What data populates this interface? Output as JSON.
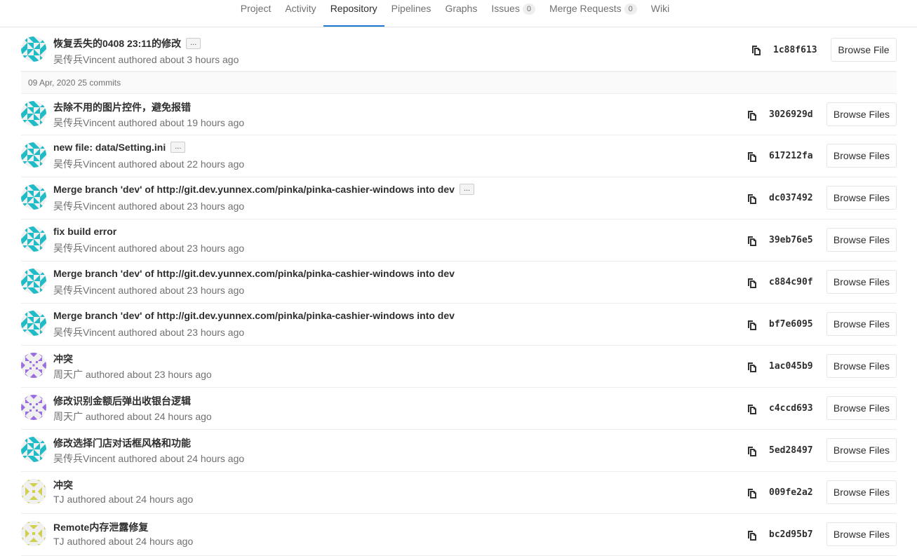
{
  "nav": {
    "tabs": [
      {
        "label": "Project"
      },
      {
        "label": "Activity"
      },
      {
        "label": "Repository"
      },
      {
        "label": "Pipelines"
      },
      {
        "label": "Graphs"
      },
      {
        "label": "Issues",
        "count": "0"
      },
      {
        "label": "Merge Requests",
        "count": "0"
      },
      {
        "label": "Wiki"
      }
    ],
    "active": "Repository"
  },
  "top_commit": {
    "title": "恢复丢失的0408 23:11的修改",
    "has_more": true,
    "meta": "吴传兵Vincent authored about 3 hours ago",
    "sha": "1c88f613",
    "button": "Browse File",
    "avatar": "teal"
  },
  "day_header": "09 Apr, 2020 25 commits",
  "commits": [
    {
      "title": "去除不用的图片控件，避免报错",
      "has_more": false,
      "meta": "吴传兵Vincent authored about 19 hours ago",
      "sha": "3026929d",
      "button": "Browse Files",
      "avatar": "teal"
    },
    {
      "title": "new file: data/Setting.ini",
      "has_more": true,
      "meta": "吴传兵Vincent authored about 22 hours ago",
      "sha": "617212fa",
      "button": "Browse Files",
      "avatar": "teal"
    },
    {
      "title": "Merge branch 'dev' of http://git.dev.yunnex.com/pinka/pinka-cashier-windows into dev",
      "has_more": true,
      "meta": "吴传兵Vincent authored about 23 hours ago",
      "sha": "dc037492",
      "button": "Browse Files",
      "avatar": "teal"
    },
    {
      "title": "fix build error",
      "has_more": false,
      "meta": "吴传兵Vincent authored about 23 hours ago",
      "sha": "39eb76e5",
      "button": "Browse Files",
      "avatar": "teal"
    },
    {
      "title": "Merge branch 'dev' of http://git.dev.yunnex.com/pinka/pinka-cashier-windows into dev",
      "has_more": false,
      "meta": "吴传兵Vincent authored about 23 hours ago",
      "sha": "c884c90f",
      "button": "Browse Files",
      "avatar": "teal"
    },
    {
      "title": "Merge branch 'dev' of http://git.dev.yunnex.com/pinka/pinka-cashier-windows into dev",
      "has_more": false,
      "meta": "吴传兵Vincent authored about 23 hours ago",
      "sha": "bf7e6095",
      "button": "Browse Files",
      "avatar": "teal"
    },
    {
      "title": "冲突",
      "has_more": false,
      "meta": "周天广 authored about 23 hours ago",
      "sha": "1ac045b9",
      "button": "Browse Files",
      "avatar": "purple"
    },
    {
      "title": "修改识别金额后弹出收银台逻辑",
      "has_more": false,
      "meta": "周天广 authored about 24 hours ago",
      "sha": "c4ccd693",
      "button": "Browse Files",
      "avatar": "purple"
    },
    {
      "title": "修改选择门店对话框风格和功能",
      "has_more": false,
      "meta": "吴传兵Vincent authored about 24 hours ago",
      "sha": "5ed28497",
      "button": "Browse Files",
      "avatar": "teal"
    },
    {
      "title": "冲突",
      "has_more": false,
      "meta": "TJ authored about 24 hours ago",
      "sha": "009fe2a2",
      "button": "Browse Files",
      "avatar": "yellow"
    },
    {
      "title": "Remote内存泄露修复",
      "has_more": false,
      "meta": "TJ authored about 24 hours ago",
      "sha": "bc2d95b7",
      "button": "Browse Files",
      "avatar": "yellow"
    }
  ],
  "ellipsis_label": "...",
  "colors": {
    "active_tab_underline": "#1f78d1",
    "avatar_teal": "#1ebcc7",
    "avatar_purple": "#9a6ee0",
    "avatar_yellow": "#cfcf50"
  },
  "icons": {
    "copy": "clipboard-icon"
  }
}
